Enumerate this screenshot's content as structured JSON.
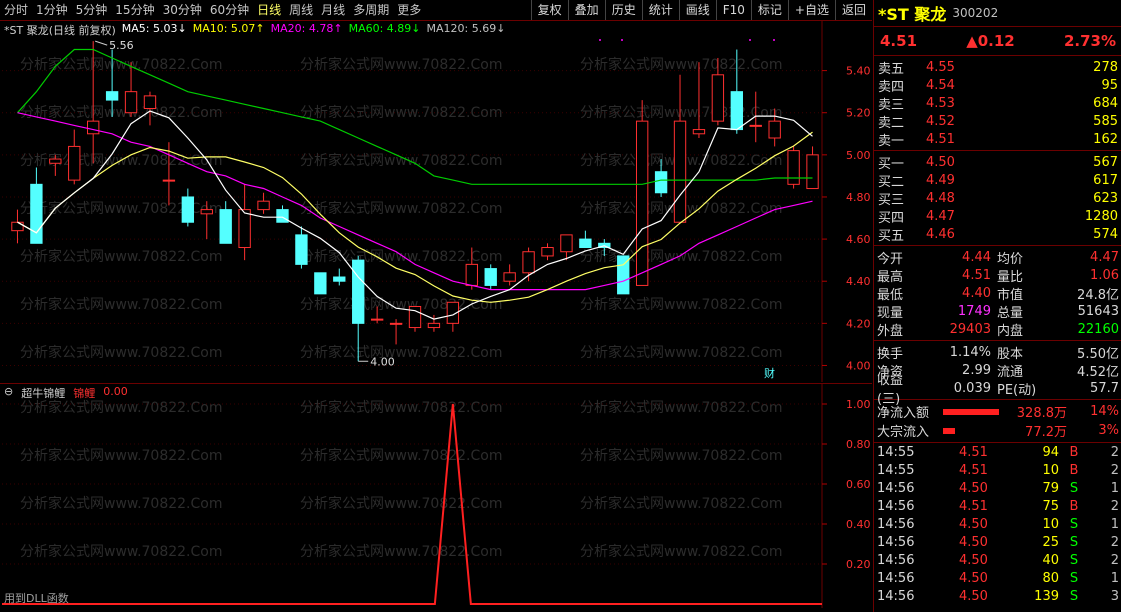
{
  "periods": [
    "分时",
    "1分钟",
    "5分钟",
    "15分钟",
    "30分钟",
    "60分钟",
    "日线",
    "周线",
    "月线",
    "多周期",
    "更多"
  ],
  "active_period": "日线",
  "tools": [
    "复权",
    "叠加",
    "历史",
    "统计",
    "画线",
    "F10",
    "标记",
    "+自选",
    "返回"
  ],
  "chart_title": "*ST 聚龙(日线 前复权)",
  "ma": [
    {
      "label": "MA5: 5.03",
      "arrow": "↓",
      "color": "#ffffff"
    },
    {
      "label": "MA10: 5.07",
      "arrow": "↑",
      "color": "#ffff00"
    },
    {
      "label": "MA20: 4.78",
      "arrow": "↑",
      "color": "#ff00ff"
    },
    {
      "label": "MA60: 4.89",
      "arrow": "↓",
      "color": "#00ff00"
    },
    {
      "label": "MA120: 5.69",
      "arrow": "↓",
      "color": "#c0c0c0"
    }
  ],
  "high_label": "5.56",
  "low_label": "4.00",
  "fin_badge": "财",
  "y_ticks": [
    "5.40",
    "5.20",
    "5.00",
    "4.80",
    "4.60",
    "4.40",
    "4.20",
    "4.00"
  ],
  "indicator": {
    "name": "超牛锦鲤",
    "series": "锦鲤",
    "value": "0.00",
    "ticks": [
      "1.00",
      "0.80",
      "0.60",
      "0.40",
      "0.20"
    ]
  },
  "dll_note": "用到DLL函数",
  "watermark": "分析家公式网www.70822.Com",
  "chart_data": {
    "type": "candlestick",
    "ylim": [
      3.95,
      5.55
    ],
    "candles": [
      [
        4.64,
        4.74,
        4.58,
        4.68
      ],
      [
        4.86,
        4.94,
        4.58,
        4.58
      ],
      [
        4.96,
        5.0,
        4.9,
        4.98
      ],
      [
        4.88,
        5.12,
        4.86,
        5.04
      ],
      [
        5.1,
        5.54,
        4.96,
        5.16
      ],
      [
        5.3,
        5.5,
        5.18,
        5.26
      ],
      [
        5.2,
        5.44,
        5.18,
        5.3
      ],
      [
        5.22,
        5.3,
        5.14,
        5.28
      ],
      [
        4.88,
        5.06,
        4.76,
        4.88
      ],
      [
        4.8,
        4.84,
        4.66,
        4.68
      ],
      [
        4.72,
        4.78,
        4.6,
        4.74
      ],
      [
        4.74,
        4.78,
        4.58,
        4.58
      ],
      [
        4.56,
        4.86,
        4.5,
        4.74
      ],
      [
        4.74,
        4.82,
        4.72,
        4.78
      ],
      [
        4.74,
        4.76,
        4.68,
        4.68
      ],
      [
        4.62,
        4.66,
        4.46,
        4.48
      ],
      [
        4.44,
        4.44,
        4.34,
        4.34
      ],
      [
        4.42,
        4.46,
        4.38,
        4.4
      ],
      [
        4.5,
        4.52,
        4.02,
        4.2
      ],
      [
        4.22,
        4.28,
        4.2,
        4.22
      ],
      [
        4.2,
        4.22,
        4.1,
        4.2
      ],
      [
        4.18,
        4.28,
        4.16,
        4.28
      ],
      [
        4.18,
        4.24,
        4.16,
        4.2
      ],
      [
        4.2,
        4.3,
        4.16,
        4.3
      ],
      [
        4.38,
        4.56,
        4.36,
        4.48
      ],
      [
        4.46,
        4.48,
        4.36,
        4.38
      ],
      [
        4.4,
        4.48,
        4.38,
        4.44
      ],
      [
        4.44,
        4.56,
        4.4,
        4.54
      ],
      [
        4.52,
        4.58,
        4.5,
        4.56
      ],
      [
        4.54,
        4.62,
        4.5,
        4.62
      ],
      [
        4.6,
        4.64,
        4.56,
        4.56
      ],
      [
        4.58,
        4.6,
        4.52,
        4.56
      ],
      [
        4.52,
        4.52,
        4.34,
        4.34
      ],
      [
        4.38,
        5.26,
        4.38,
        5.16
      ],
      [
        4.92,
        4.98,
        4.8,
        4.82
      ],
      [
        4.68,
        5.38,
        4.7,
        5.16
      ],
      [
        5.1,
        5.44,
        5.08,
        5.12
      ],
      [
        5.16,
        5.46,
        5.14,
        5.38
      ],
      [
        5.3,
        5.5,
        5.1,
        5.12
      ],
      [
        5.14,
        5.3,
        5.06,
        5.14
      ],
      [
        5.08,
        5.22,
        5.04,
        5.16
      ],
      [
        4.86,
        5.04,
        4.84,
        5.02
      ],
      [
        4.84,
        5.04,
        4.84,
        5.0
      ]
    ],
    "indicator_peak": 1.0
  },
  "quote": {
    "name": "*ST 聚龙",
    "code": "300202",
    "price": "4.51",
    "change": "▲0.12",
    "pct": "2.73%",
    "asks": [
      [
        "卖五",
        "4.55",
        "278"
      ],
      [
        "卖四",
        "4.54",
        "95"
      ],
      [
        "卖三",
        "4.53",
        "684"
      ],
      [
        "卖二",
        "4.52",
        "585"
      ],
      [
        "卖一",
        "4.51",
        "162"
      ]
    ],
    "bids": [
      [
        "买一",
        "4.50",
        "567"
      ],
      [
        "买二",
        "4.49",
        "617"
      ],
      [
        "买三",
        "4.48",
        "623"
      ],
      [
        "买四",
        "4.47",
        "1280"
      ],
      [
        "买五",
        "4.46",
        "574"
      ]
    ],
    "stats": [
      [
        "今开",
        "4.44",
        "均价",
        "4.47",
        "#ff3030",
        "#ff3030"
      ],
      [
        "最高",
        "4.51",
        "量比",
        "1.06",
        "#ff3030",
        "#ff3030"
      ],
      [
        "最低",
        "4.40",
        "市值",
        "24.8亿",
        "#ff3030",
        "#d8d8d8"
      ],
      [
        "现量",
        "1749",
        "总量",
        "51643",
        "#ff30ff",
        "#d8d8d8"
      ],
      [
        "外盘",
        "29403",
        "内盘",
        "22160",
        "#ff3030",
        "#00ff00"
      ]
    ],
    "fund": [
      [
        "换手",
        "1.14%",
        "股本",
        "5.50亿"
      ],
      [
        "净资",
        "2.99",
        "流通",
        "4.52亿"
      ],
      [
        "收益(三)",
        "0.039",
        "PE(动)",
        "57.7"
      ]
    ],
    "flows": [
      [
        "净流入额",
        "328.8万",
        "14%",
        56
      ],
      [
        "大宗流入",
        "77.2万",
        "3%",
        12
      ]
    ],
    "ticks": [
      [
        "14:55",
        "4.51",
        "94",
        "B",
        "2"
      ],
      [
        "14:55",
        "4.51",
        "10",
        "B",
        "2"
      ],
      [
        "14:56",
        "4.50",
        "79",
        "S",
        "1"
      ],
      [
        "14:56",
        "4.51",
        "75",
        "B",
        "2"
      ],
      [
        "14:56",
        "4.50",
        "10",
        "S",
        "1"
      ],
      [
        "14:56",
        "4.50",
        "25",
        "S",
        "2"
      ],
      [
        "14:56",
        "4.50",
        "40",
        "S",
        "2"
      ],
      [
        "14:56",
        "4.50",
        "80",
        "S",
        "1"
      ],
      [
        "14:56",
        "4.50",
        "139",
        "S",
        "3"
      ]
    ]
  }
}
